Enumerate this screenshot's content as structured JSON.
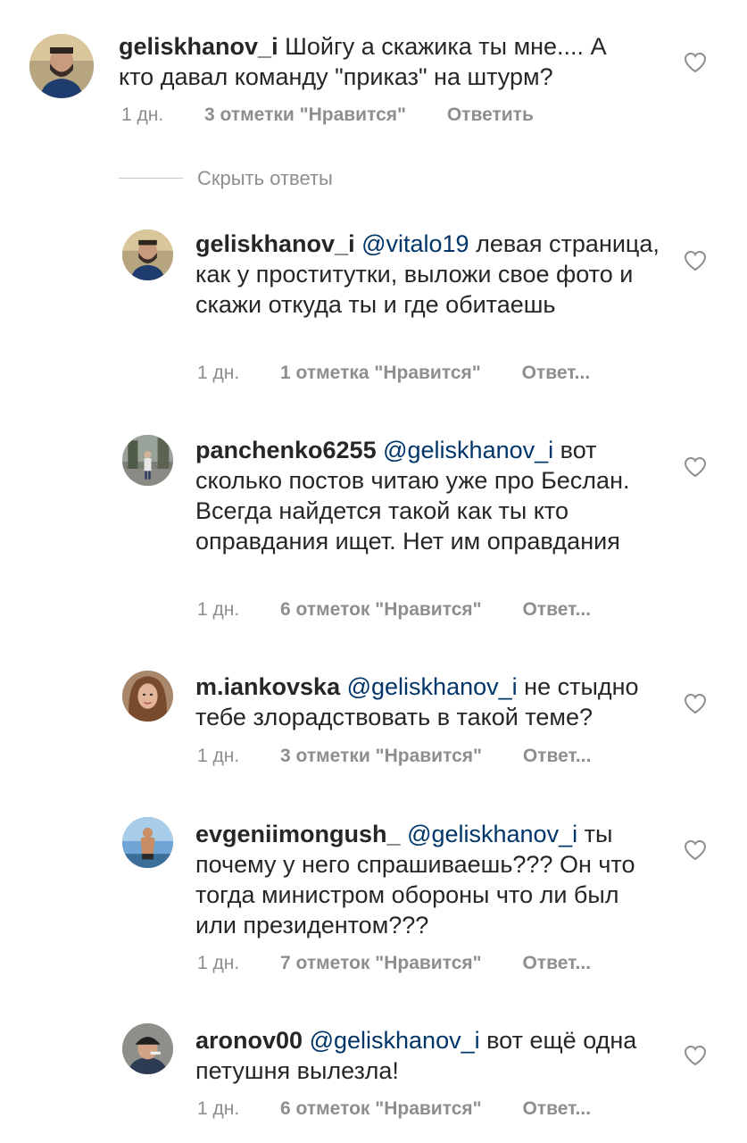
{
  "comments": [
    {
      "username": "geliskhanov_i",
      "mention": "",
      "text": "Шойгу а скажика ты мне.... А кто давал команду \"приказ\" на штурм?",
      "time": "1 дн.",
      "likes": "3 отметки \"Нравится\"",
      "reply": "Ответить",
      "avatar_icon": "avatar-man-beard"
    },
    {
      "username": "geliskhanov_i",
      "mention": "@vitalo19",
      "text": "левая страница, как у проститутки, выложи свое фото и скажи откуда ты и где обитаешь",
      "time": "1 дн.",
      "likes": "1 отметка \"Нравится\"",
      "reply": "Ответ...",
      "avatar_icon": "avatar-man-beard"
    },
    {
      "username": "panchenko6255",
      "mention": "@geliskhanov_i",
      "text": "вот сколько постов читаю уже про Беслан. Всегда найдется такой как ты кто оправдания ищет.  Нет им оправдания",
      "time": "1 дн.",
      "likes": "6 отметок \"Нравится\"",
      "reply": "Ответ...",
      "avatar_icon": "avatar-person-street"
    },
    {
      "username": "m.iankovska",
      "mention": "@geliskhanov_i",
      "text": " не стыдно тебе злорадствовать в такой теме?",
      "time": "1 дн.",
      "likes": "3 отметки \"Нравится\"",
      "reply": "Ответ...",
      "avatar_icon": "avatar-woman"
    },
    {
      "username": "evgeniimongush_",
      "mention": "@geliskhanov_i",
      "text": "ты почему у него спрашиваешь??? Он что тогда министром обороны что ли был или президентом???",
      "time": "1 дн.",
      "likes": "7 отметок \"Нравится\"",
      "reply": "Ответ...",
      "avatar_icon": "avatar-man-beach"
    },
    {
      "username": "aronov00",
      "mention": "@geliskhanov_i",
      "text": "вот ещё одна петушня вылезла!",
      "time": "1 дн.",
      "likes": "6 отметок \"Нравится\"",
      "reply": "Ответ...",
      "avatar_icon": "avatar-man-cap"
    }
  ],
  "hide_replies": "Скрыть ответы",
  "icons": {
    "like": "heart-outline-icon"
  },
  "colors": {
    "text": "#262626",
    "muted": "#8e8e8e",
    "mention": "#003569"
  }
}
